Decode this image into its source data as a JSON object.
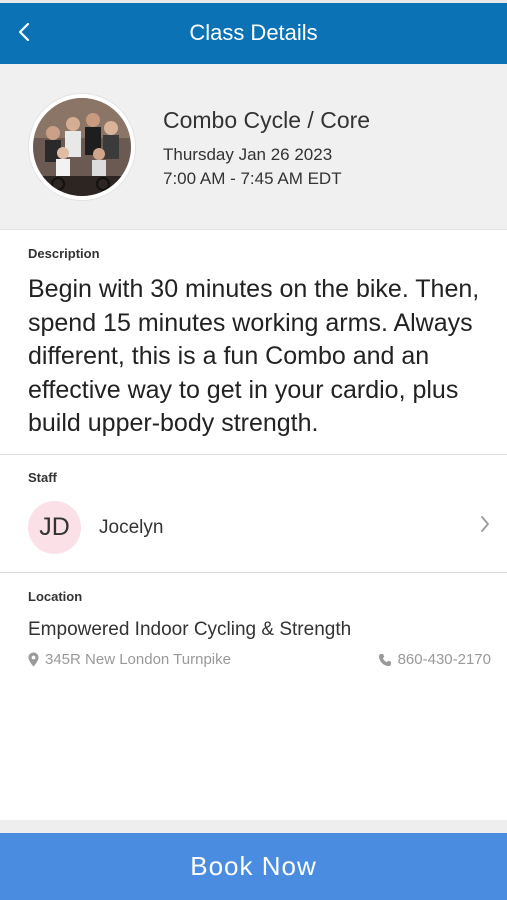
{
  "header": {
    "title": "Class Details",
    "back_icon": "chevron-left-icon"
  },
  "class_info": {
    "name": "Combo Cycle / Core",
    "date": "Thursday Jan 26 2023",
    "time": "7:00 AM - 7:45 AM EDT",
    "photo": "class-photo"
  },
  "description": {
    "label": "Description",
    "text": "Begin with 30 minutes on the bike. Then, spend 15 minutes working arms. Always different, this is a fun Combo and an effective way to get in your cardio, plus build upper-body strength."
  },
  "staff": {
    "label": "Staff",
    "initials": "JD",
    "name": "Jocelyn",
    "chevron_icon": "chevron-right-icon"
  },
  "location": {
    "label": "Location",
    "name": "Empowered Indoor Cycling & Strength",
    "address": "345R New London Turnpike",
    "phone": "860-430-2170",
    "address_icon": "map-pin-icon",
    "phone_icon": "phone-icon"
  },
  "actions": {
    "book_label": "Book Now"
  },
  "colors": {
    "header_bg": "#0a72b5",
    "book_button_bg": "#4a8de0",
    "staff_avatar_bg": "#fbe0e8"
  }
}
